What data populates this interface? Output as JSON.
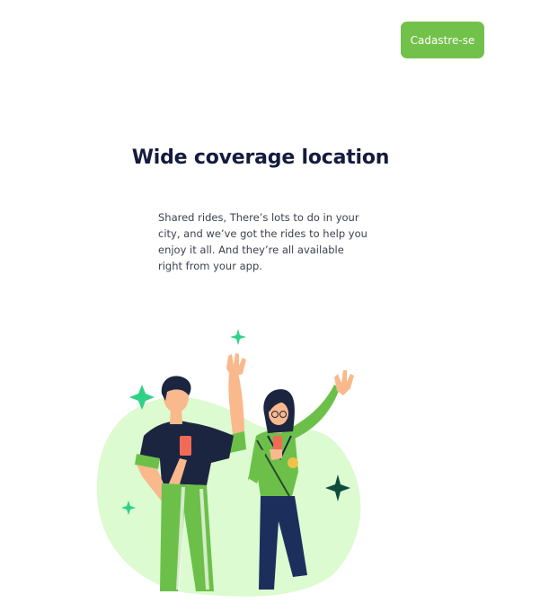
{
  "header": {
    "signup_label": "Cadastre-se"
  },
  "hero": {
    "title": "Wide coverage location",
    "description": "Shared rides, There’s lots to do in your city, and we’ve got the rides to help you enjoy it all. And they’re all available right from your app."
  },
  "colors": {
    "accent": "#72c14a",
    "title": "#151b3e",
    "body_text": "#3e4050",
    "blob": "#dcfbd0",
    "sparkle_green": "#2fd187",
    "sparkle_dark": "#0d4c3c"
  },
  "illustration": {
    "icons": [
      "sparkle-icon",
      "person-man-waving",
      "person-woman-waving"
    ]
  }
}
